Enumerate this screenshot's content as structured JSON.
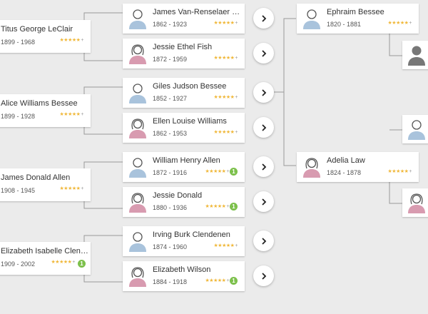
{
  "colors": {
    "male": "#a9c3dc",
    "female": "#d89bb0",
    "unknown": "#777777",
    "star": "#f0b83a",
    "badge": "#7cc04b"
  },
  "grandparents": [
    {
      "name": "Titus George LeClair",
      "dates": "1899 - 1968",
      "stars": "★★★★★",
      "plus": "+"
    },
    {
      "name": "Alice Williams Bessee",
      "dates": "1899 - 1928",
      "stars": "★★★★★",
      "plus": "+"
    },
    {
      "name": "James Donald Allen",
      "dates": "1908 - 1945",
      "stars": "★★★★★",
      "plus": "+"
    },
    {
      "name": "Elizabeth Isabelle Clendenen",
      "dates": "1909 - 2002",
      "stars": "★★★★★",
      "plus": "+",
      "badge": "1"
    }
  ],
  "parents": [
    {
      "name": "James Van-Renselaer LeClair",
      "dates": "1862 - 1923",
      "stars": "★★★★★",
      "plus": "+",
      "gender": "male"
    },
    {
      "name": "Jessie Ethel Fish",
      "dates": "1872 - 1959",
      "stars": "★★★★★",
      "plus": "+",
      "gender": "female"
    },
    {
      "name": "Giles Judson Bessee",
      "dates": "1852 - 1927",
      "stars": "★★★★★",
      "plus": "+",
      "gender": "male"
    },
    {
      "name": "Ellen Louise Williams",
      "dates": "1862 - 1953",
      "stars": "★★★★★",
      "plus": "+",
      "gender": "female"
    },
    {
      "name": "William Henry Allen",
      "dates": "1872 - 1916",
      "stars": "★★★★★",
      "plus": "+",
      "gender": "male",
      "badge": "1"
    },
    {
      "name": "Jessie Donald",
      "dates": "1880 - 1936",
      "stars": "★★★★★",
      "plus": "+",
      "gender": "female",
      "badge": "1"
    },
    {
      "name": "Irving Burk Clendenen",
      "dates": "1874 - 1960",
      "stars": "★★★★★",
      "plus": "+",
      "gender": "male"
    },
    {
      "name": "Elizabeth Wilson",
      "dates": "1884 - 1918",
      "stars": "★★★★★",
      "plus": "+",
      "gender": "female",
      "badge": "1"
    }
  ],
  "ancestors": [
    {
      "name": "Ephraim Bessee",
      "dates": "1820 - 1881",
      "stars": "★★★★★",
      "plus": "+",
      "gender": "male"
    },
    {
      "name": "Adelia Law",
      "dates": "1824 - 1878",
      "stars": "★★★★★",
      "plus": "+",
      "gender": "female"
    }
  ],
  "next_generation": [
    "unknown",
    "male",
    "female"
  ],
  "nav_icon": "chevron-right-icon"
}
